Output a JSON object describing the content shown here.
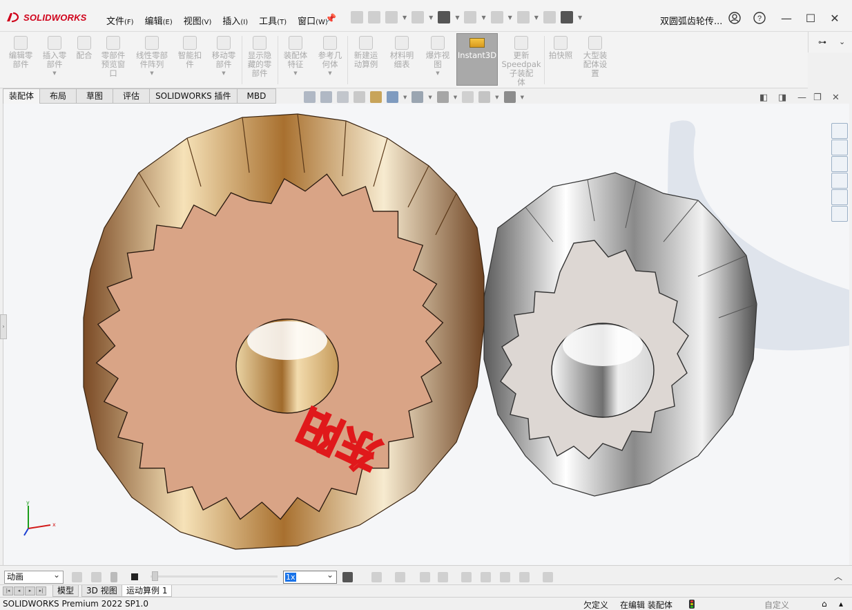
{
  "app": {
    "logo_text": "SOLIDWORKS",
    "doc_title": "双圆弧齿轮传..."
  },
  "menu": [
    {
      "label": "文件",
      "key": "(F)"
    },
    {
      "label": "编辑",
      "key": "(E)"
    },
    {
      "label": "视图",
      "key": "(V)"
    },
    {
      "label": "插入",
      "key": "(I)"
    },
    {
      "label": "工具",
      "key": "(T)"
    },
    {
      "label": "窗口",
      "key": "(W)"
    }
  ],
  "ribbon": {
    "buttons": [
      "编辑零\n部件",
      "插入零\n部件",
      "配合",
      "零部件\n预览窗\n口",
      "线性零部\n件阵列",
      "智能扣\n件",
      "移动零\n部件",
      "显示隐\n藏的零\n部件",
      "装配体\n特征",
      "参考几\n何体",
      "新建运\n动算例",
      "材料明\n细表",
      "爆炸视\n图",
      "更新\nSpeedpak\n子装配\n体",
      "拍快照",
      "大型装\n配体设\n置"
    ],
    "instant3d": "Instant3D"
  },
  "tabs": [
    "装配体",
    "布局",
    "草图",
    "评估",
    "SOLIDWORKS 插件",
    "MBD"
  ],
  "graphics": {
    "gear_text": "东阳",
    "accent_colors": {
      "large_gear": "#d9a486",
      "small_gear": "#ddd7d3",
      "text": "#e0191b"
    },
    "triad": {
      "x": "x",
      "y": "y"
    }
  },
  "motion": {
    "type_select": "动画",
    "speed_select": "1x"
  },
  "bottom_tabs": [
    "模型",
    "3D 视图",
    "运动算例 1"
  ],
  "status": {
    "product": "SOLIDWORKS Premium 2022 SP1.0",
    "definition": "欠定义",
    "editing": "在编辑 装配体",
    "custom": "自定义"
  },
  "icons": [
    "home-icon",
    "new-icon",
    "open-icon",
    "save-icon",
    "print-icon",
    "undo-icon",
    "redo-icon",
    "select-icon",
    "rebuild-icon",
    "options-icon",
    "account-icon",
    "help-icon"
  ]
}
